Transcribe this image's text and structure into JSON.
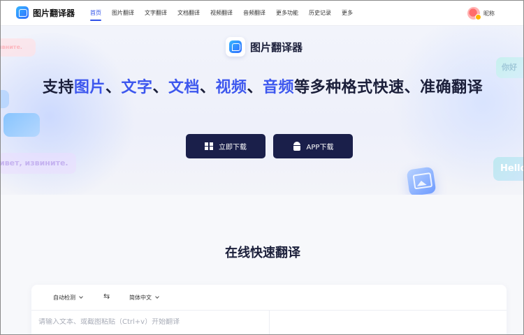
{
  "nav": {
    "logo_text": "图片翻译器",
    "items": [
      {
        "label": "首页",
        "active": true
      },
      {
        "label": "图片翻译",
        "active": false
      },
      {
        "label": "文字翻译",
        "active": false
      },
      {
        "label": "文档翻译",
        "active": false
      },
      {
        "label": "视频翻译",
        "active": false
      },
      {
        "label": "音频翻译",
        "active": false
      },
      {
        "label": "更多功能",
        "active": false
      },
      {
        "label": "历史记录",
        "active": false
      },
      {
        "label": "更多",
        "active": false
      }
    ],
    "user_nickname": "昵称",
    "accent_color": "#2f52e8"
  },
  "hero": {
    "brand_name": "图片翻译器",
    "headline": {
      "prefix": "支持",
      "h1": "图片",
      "sep1": "、",
      "h2": "文字",
      "sep2": "、",
      "h3": "文档",
      "sep3": "、",
      "h4": "视频",
      "sep4": "、",
      "h5": "音频",
      "suffix": "等多种格式快速、准确翻译"
    },
    "highlight_color": "#3d57ee",
    "download_button": "立即下载",
    "app_button": "APP下载",
    "decor": {
      "bubble_ru_small": "ивните.",
      "bubble_ru_large": "ивет, извините.",
      "bubble_zh": "你好",
      "bubble_en": "Hello"
    }
  },
  "translate": {
    "title": "在线快速翻译",
    "source_lang": "自动检测",
    "target_lang": "简体中文",
    "input_placeholder": "请输入文本、或截图粘贴（Ctrl+v）开始翻译",
    "input_value": ""
  }
}
